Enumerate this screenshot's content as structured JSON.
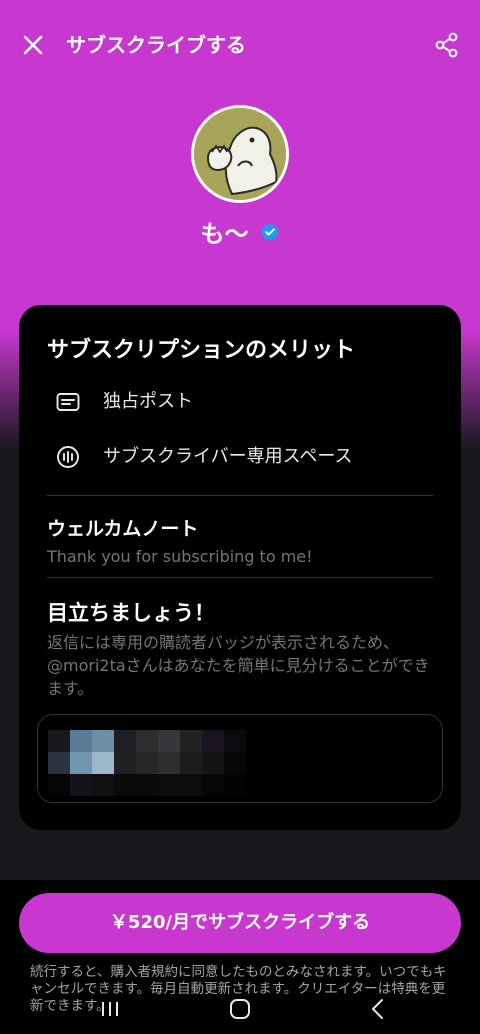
{
  "header": {
    "title": "サブスクライブする",
    "close_icon": "close-icon",
    "share_icon": "share-icon"
  },
  "creator": {
    "name": "も〜",
    "verified": true,
    "verified_icon": "verified-badge-icon"
  },
  "card": {
    "title": "サブスクリプションのメリット",
    "benefits": [
      {
        "icon": "post-icon",
        "label": "独占ポスト"
      },
      {
        "icon": "spaces-icon",
        "label": "サブスクライバー専用スペース"
      }
    ],
    "welcome": {
      "title": "ウェルカムノート",
      "message": "Thank you for subscribing to me!"
    },
    "stand_out": {
      "title": "目立ちましょう！",
      "description": "返信には専用の購読者バッジが表示されるため、@mori2taさんはあなたを簡単に見分けることができます。"
    }
  },
  "subscribe": {
    "button_label": "￥520/月でサブスクライブする",
    "legal": "続行すると、購入者規約に同意したものとみなされます。いつでもキャンセルできます。毎月自動更新されます。クリエイターは特典を更新できます。"
  },
  "navbar": {
    "items": [
      "recent-apps-icon",
      "home-icon",
      "back-icon"
    ]
  },
  "colors": {
    "accent": "#c837cf",
    "card_bg": "#000000",
    "verified": "#1d9bf0",
    "muted_text": "#71767b"
  }
}
